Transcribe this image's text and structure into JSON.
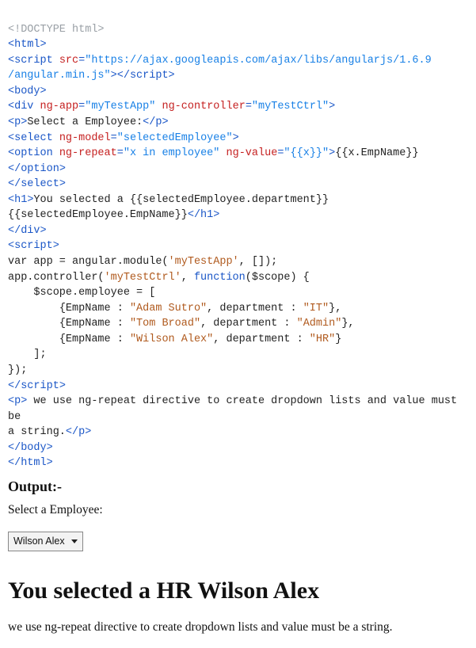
{
  "code": {
    "l1": "<!DOCTYPE html>",
    "l2_open": "<",
    "l2_tag": "html",
    "l2_close": ">",
    "l3_open": "<",
    "l3_tag": "script",
    "l3_attr_src": "src",
    "l3_val_src": "\"https://ajax.googleapis.com/ajax/libs/angularjs/1.6.9",
    "l3b_val_src": "/angular.min.js\"",
    "l3_close1": ">",
    "l3_endopen": "</",
    "l3_endtag": "script",
    "l3_endclose": ">",
    "l4_open": "<",
    "l4_tag": "body",
    "l4_close": ">",
    "l5_open": "<",
    "l5_tag": "div",
    "l5_a1": "ng-app",
    "l5_v1": "\"myTestApp\"",
    "l5_a2": "ng-controller",
    "l5_v2": "\"myTestCtrl\"",
    "l5_close": ">",
    "l6_open": "<",
    "l6_tag": "p",
    "l6_close": ">",
    "l6_text": "Select a Employee:",
    "l6_endopen": "</",
    "l6_endtag": "p",
    "l6_endclose": ">",
    "l7_open": "<",
    "l7_tag": "select",
    "l7_a1": "ng-model",
    "l7_v1": "\"selectedEmployee\"",
    "l7_close": ">",
    "l8_open": "<",
    "l8_tag": "option",
    "l8_a1": "ng-repeat",
    "l8_v1": "\"x in employee\"",
    "l8_a2": "ng-value",
    "l8_v2": "\"{{x}}\"",
    "l8_close": ">",
    "l8_text": "{{x.EmpName}}",
    "l8_endopen": "</",
    "l8_endtag": "option",
    "l8_endclose": ">",
    "l9_open": "</",
    "l9_tag": "select",
    "l9_close": ">",
    "l10_open": "<",
    "l10_tag": "h1",
    "l10_close": ">",
    "l10_text1": "You selected a {{selectedEmployee.department}}",
    "l10b_text": "{{selectedEmployee.EmpName}}",
    "l10_endopen": "</",
    "l10_endtag": "h1",
    "l10_endclose": ">",
    "l11_open": "</",
    "l11_tag": "div",
    "l11_close": ">",
    "l12_open": "<",
    "l12_tag": "script",
    "l12_close": ">",
    "js_l1_a": "var app = angular.module(",
    "js_l1_s": "'myTestApp'",
    "js_l1_b": ", []);",
    "js_l2_a": "app.controller(",
    "js_l2_s": "'myTestCtrl'",
    "js_l2_b": ", ",
    "js_l2_fn": "function",
    "js_l2_c": "($scope) {",
    "js_l3": "    $scope.employee = [",
    "js_l4_a": "        {EmpName : ",
    "js_l4_s1": "\"Adam Sutro\"",
    "js_l4_b": ", department : ",
    "js_l4_s2": "\"IT\"",
    "js_l4_c": "},",
    "js_l5_a": "        {EmpName : ",
    "js_l5_s1": "\"Tom Broad\"",
    "js_l5_b": ", department : ",
    "js_l5_s2": "\"Admin\"",
    "js_l5_c": "},",
    "js_l6_a": "        {EmpName : ",
    "js_l6_s1": "\"Wilson Alex\"",
    "js_l6_b": ", department : ",
    "js_l6_s2": "\"HR\"",
    "js_l6_c": "}",
    "js_l7": "    ];",
    "js_l8": "});",
    "l13_open": "</",
    "l13_tag": "script",
    "l13_close": ">",
    "l14_open": "<",
    "l14_tag": "p",
    "l14_close": ">",
    "l14_text1": " we use ng-repeat directive to create dropdown lists and value must be",
    "l14b_text": "a string.",
    "l14_endopen": "</",
    "l14_endtag": "p",
    "l14_endclose": ">",
    "l15_open": "</",
    "l15_tag": "body",
    "l15_close": ">",
    "l16_open": "</",
    "l16_tag": "html",
    "l16_close": ">"
  },
  "output": {
    "heading": "Output:-",
    "label": "Select a Employee:",
    "selected": "Wilson Alex",
    "h1": "You selected a HR Wilson Alex",
    "note": "we use ng-repeat directive to create dropdown lists and value must be a string."
  }
}
